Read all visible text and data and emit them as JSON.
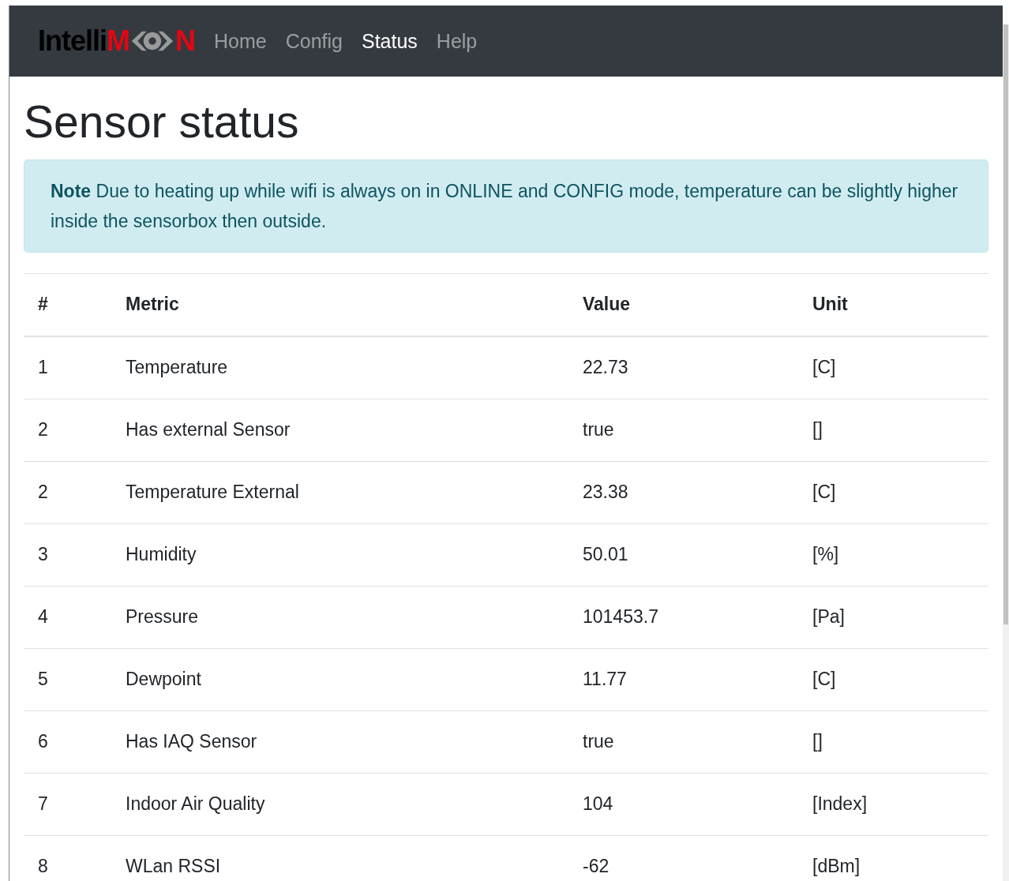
{
  "navbar": {
    "logo": {
      "prefix": "Intelli",
      "highlight_start": "M",
      "highlight_end": "N"
    },
    "items": [
      {
        "label": "Home",
        "selected": false
      },
      {
        "label": "Config",
        "selected": false
      },
      {
        "label": "Status",
        "selected": true
      },
      {
        "label": "Help",
        "selected": false
      }
    ]
  },
  "title": "Sensor status",
  "alert": {
    "text": "**Note** Due to heating up while wifi is always on in ONLINE and CONFIG mode, temperature can be slightly higher inside the sensorbox then outside."
  },
  "table": {
    "columns": [
      "#",
      "Metric",
      "Value",
      "Unit"
    ],
    "rows": [
      [
        "1",
        "Temperature",
        "22.73",
        "[C]"
      ],
      [
        "2",
        "Has external Sensor",
        "true",
        "[]"
      ],
      [
        "2",
        "Temperature External",
        "23.38",
        "[C]"
      ],
      [
        "3",
        "Humidity",
        "50.01",
        "[%]"
      ],
      [
        "4",
        "Pressure",
        "101453.7",
        "[Pa]"
      ],
      [
        "5",
        "Dewpoint",
        "11.77",
        "[C]"
      ],
      [
        "6",
        "Has IAQ Sensor",
        "true",
        "[]"
      ],
      [
        "7",
        "Indoor Air Quality",
        "104",
        "[Index]"
      ],
      [
        "8",
        "WLan RSSI",
        "-62",
        "[dBm]"
      ]
    ]
  }
}
